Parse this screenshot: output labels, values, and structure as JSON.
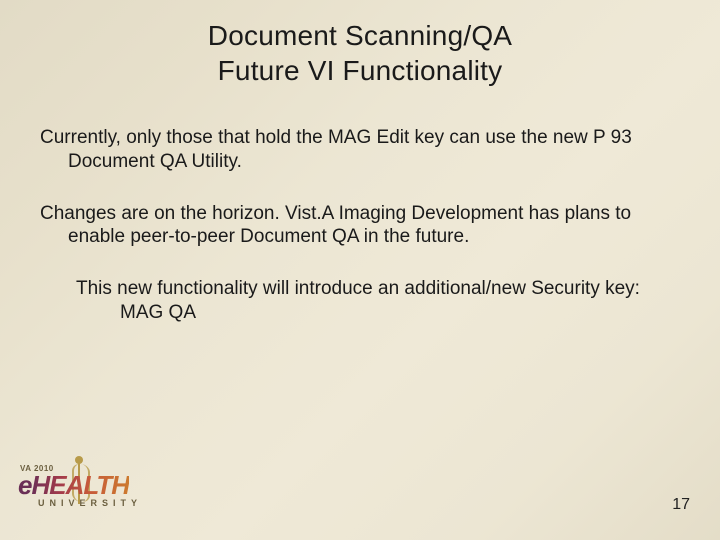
{
  "title_line1": "Document Scanning/QA",
  "title_line2": "Future VI Functionality",
  "para1": "Currently, only those that hold the MAG Edit key can use the new P 93 Document QA Utility.",
  "para2": "Changes are on the horizon.  Vist.A Imaging Development has plans to enable peer-to-peer Document QA in the future.",
  "para3": "This new functionality will introduce an additional/new Security key:  MAG QA",
  "page_number": "17",
  "logo": {
    "tagline": "VA 2010",
    "brand_e": "e",
    "brand_rest": "HEALTH",
    "subtext": "UNIVERSITY"
  }
}
